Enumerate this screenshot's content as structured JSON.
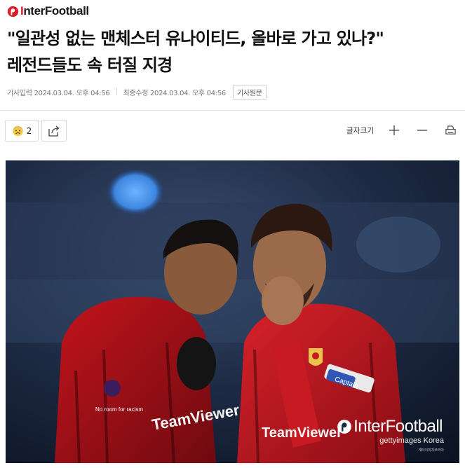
{
  "brand": {
    "name_prefix": "I",
    "name_rest": "nterFootball",
    "accent": "#d81e2a"
  },
  "article": {
    "headline_line1": "\"일관성 없는 맨체스터 유나이티드, 올바로 가고 있나?\"",
    "headline_line2": "레전드들도 속 터질 지경",
    "published": "기사입력 2024.03.04. 오후 04:56",
    "modified": "최종수정 2024.03.04. 오후 04:56",
    "original_link": "기사원문"
  },
  "toolbar": {
    "reaction_icon": "sad-face-emoji",
    "reaction_count": "2",
    "share_icon": "share-icon",
    "font_size_label": "글자크기",
    "increase_icon": "plus-icon",
    "decrease_icon": "minus-icon",
    "print_icon": "print-icon"
  },
  "photo": {
    "watermark_prefix": "I",
    "watermark_rest": "nterFootball",
    "credit": "gettyimages Korea",
    "credit_sub": "게티이미지코리아",
    "sleeve_text_left": "No room for racism",
    "shirt_sponsor": "TeamViewer",
    "captain_band": "Captain"
  }
}
